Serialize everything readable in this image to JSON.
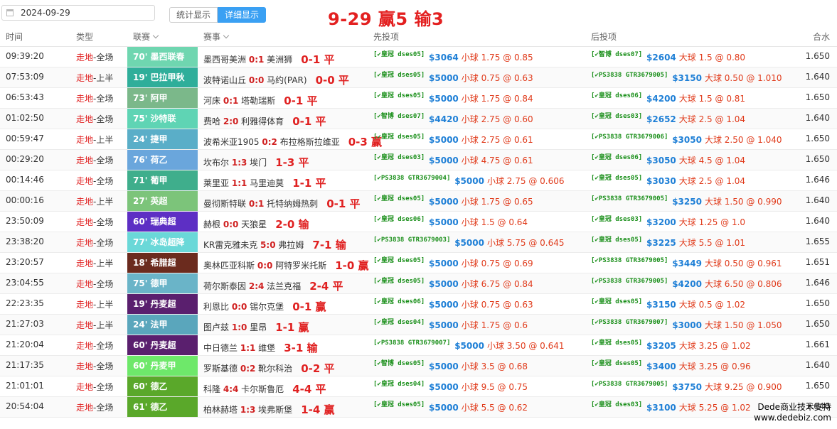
{
  "toolbar": {
    "date_value": "2024-09-29",
    "btn_stats": "统计显示",
    "btn_detail": "详细显示",
    "summary": "9-29 赢5 输3"
  },
  "headers": {
    "time": "时间",
    "type": "类型",
    "league": "联赛",
    "match": "赛事",
    "first_bet": "先投项",
    "second_bet": "后投项",
    "rate": "合水"
  },
  "rows": [
    {
      "time": "09:39:20",
      "type_a": "走地",
      "type_b": "-全场",
      "league": "70' 墨西联春",
      "league_color": "#6fd6b0",
      "home": "墨西哥美洲",
      "score": "0:1",
      "away": "美洲狮",
      "result": "0-1 平",
      "b1_acct": "[✔皇冠 dses05]",
      "b1_amt": "$3064",
      "b1_pick": "小球",
      "b1_odds": "1.75 @ 0.85",
      "b2_acct": "[✔智博 dses07]",
      "b2_amt": "$2604",
      "b2_pick": "大球",
      "b2_odds": "1.5 @ 0.80",
      "rate": "1.650"
    },
    {
      "time": "07:53:09",
      "type_a": "走地",
      "type_b": "-上半",
      "league": "19' 巴拉甲秋",
      "league_color": "#2fae9a",
      "home": "波特诺山丘",
      "score": "0:0",
      "away": "马约(PAR)",
      "result": "0-0 平",
      "b1_acct": "[✔皇冠 dses05]",
      "b1_amt": "$5000",
      "b1_pick": "小球",
      "b1_odds": "0.75 @ 0.63",
      "b2_acct": "[✔PS3838 GTR3679005]",
      "b2_amt": "$3150",
      "b2_pick": "大球",
      "b2_odds": "0.50 @ 1.010",
      "rate": "1.640"
    },
    {
      "time": "06:53:43",
      "type_a": "走地",
      "type_b": "-全场",
      "league": "73' 阿甲",
      "league_color": "#7bb88a",
      "home": "河床",
      "score": "0:1",
      "away": "塔勒瑞斯",
      "result": "0-1 平",
      "b1_acct": "[✔皇冠 dses05]",
      "b1_amt": "$5000",
      "b1_pick": "小球",
      "b1_odds": "1.75 @ 0.84",
      "b2_acct": "[✔皇冠 dses06]",
      "b2_amt": "$4200",
      "b2_pick": "大球",
      "b2_odds": "1.5 @ 0.81",
      "rate": "1.650"
    },
    {
      "time": "01:02:50",
      "type_a": "走地",
      "type_b": "-全场",
      "league": "75' 沙特联",
      "league_color": "#5fd4b4",
      "home": "费哈",
      "score": "2:0",
      "away": "利雅得体育",
      "result": "0-1 平",
      "b1_acct": "[✔智博 dses07]",
      "b1_amt": "$4420",
      "b1_pick": "小球",
      "b1_odds": "2.75 @ 0.60",
      "b2_acct": "[✔皇冠 dses03]",
      "b2_amt": "$2652",
      "b2_pick": "大球",
      "b2_odds": "2.5 @ 1.04",
      "rate": "1.640"
    },
    {
      "time": "00:59:47",
      "type_a": "走地",
      "type_b": "-上半",
      "league": "24' 捷甲",
      "league_color": "#5aaec8",
      "home": "波希米亚1905",
      "score": "0:2",
      "away": "布拉格斯拉维亚",
      "result": "0-3 赢",
      "b1_acct": "[✔皇冠 dses05]",
      "b1_amt": "$5000",
      "b1_pick": "小球",
      "b1_odds": "2.75 @ 0.61",
      "b2_acct": "[✔PS3838 GTR3679006]",
      "b2_amt": "$3050",
      "b2_pick": "大球",
      "b2_odds": "2.50 @ 1.040",
      "rate": "1.650"
    },
    {
      "time": "00:29:20",
      "type_a": "走地",
      "type_b": "-全场",
      "league": "76' 荷乙",
      "league_color": "#6aa6dc",
      "home": "坎布尔",
      "score": "1:3",
      "away": "埃门",
      "result": "1-3 平",
      "b1_acct": "[✔皇冠 dses03]",
      "b1_amt": "$5000",
      "b1_pick": "小球",
      "b1_odds": "4.75 @ 0.61",
      "b2_acct": "[✔皇冠 dses06]",
      "b2_amt": "$3050",
      "b2_pick": "大球",
      "b2_odds": "4.5 @ 1.04",
      "rate": "1.650"
    },
    {
      "time": "00:14:46",
      "type_a": "走地",
      "type_b": "-全场",
      "league": "71' 葡甲",
      "league_color": "#3fae8c",
      "home": "莱里亚",
      "score": "1:1",
      "away": "马里迪莫",
      "result": "1-1 平",
      "b1_acct": "[✔PS3838 GTR3679004]",
      "b1_amt": "$5000",
      "b1_pick": "小球",
      "b1_odds": "2.75 @ 0.606",
      "b2_acct": "[✔皇冠 dses05]",
      "b2_amt": "$3030",
      "b2_pick": "大球",
      "b2_odds": "2.5 @ 1.04",
      "rate": "1.646"
    },
    {
      "time": "00:00:16",
      "type_a": "走地",
      "type_b": "-上半",
      "league": "27' 英超",
      "league_color": "#7cc47a",
      "home": "曼彻斯特联",
      "score": "0:1",
      "away": "托特纳姆热刺",
      "result": "0-1 平",
      "b1_acct": "[✔皇冠 dses05]",
      "b1_amt": "$5000",
      "b1_pick": "小球",
      "b1_odds": "1.75 @ 0.65",
      "b2_acct": "[✔PS3838 GTR3679005]",
      "b2_amt": "$3250",
      "b2_pick": "大球",
      "b2_odds": "1.50 @ 0.990",
      "rate": "1.640"
    },
    {
      "time": "23:50:09",
      "type_a": "走地",
      "type_b": "-全场",
      "league": "60' 瑞典超",
      "league_color": "#5d2fc4",
      "home": "赫根",
      "score": "0:0",
      "away": "天狼星",
      "result": "2-0 输",
      "b1_acct": "[✔皇冠 dses06]",
      "b1_amt": "$5000",
      "b1_pick": "小球",
      "b1_odds": "1.5 @ 0.64",
      "b2_acct": "[✔皇冠 dses03]",
      "b2_amt": "$3200",
      "b2_pick": "大球",
      "b2_odds": "1.25 @ 1.0",
      "rate": "1.640"
    },
    {
      "time": "23:38:20",
      "type_a": "走地",
      "type_b": "-全场",
      "league": "77' 冰岛超降",
      "league_color": "#6ad8d8",
      "home": "KR雷克雅未克",
      "score": "5:0",
      "away": "弗拉姆",
      "result": "7-1 输",
      "b1_acct": "[✔PS3838 GTR3679003]",
      "b1_amt": "$5000",
      "b1_pick": "小球",
      "b1_odds": "5.75 @ 0.645",
      "b2_acct": "[✔皇冠 dses05]",
      "b2_amt": "$3225",
      "b2_pick": "大球",
      "b2_odds": "5.5 @ 1.01",
      "rate": "1.655"
    },
    {
      "time": "23:20:57",
      "type_a": "走地",
      "type_b": "-上半",
      "league": "18' 希腊超",
      "league_color": "#6b2b1e",
      "home": "奥林匹亚科斯",
      "score": "0:0",
      "away": "阿特罗米托斯",
      "result": "1-0 赢",
      "b1_acct": "[✔皇冠 dses05]",
      "b1_amt": "$5000",
      "b1_pick": "小球",
      "b1_odds": "0.75 @ 0.69",
      "b2_acct": "[✔PS3838 GTR3679005]",
      "b2_amt": "$3449",
      "b2_pick": "大球",
      "b2_odds": "0.50 @ 0.961",
      "rate": "1.651"
    },
    {
      "time": "23:04:55",
      "type_a": "走地",
      "type_b": "-全场",
      "league": "75' 德甲",
      "league_color": "#6ab4c8",
      "home": "荷尔斯泰因",
      "score": "2:4",
      "away": "法兰克福",
      "result": "2-4 平",
      "b1_acct": "[✔皇冠 dses05]",
      "b1_amt": "$5000",
      "b1_pick": "小球",
      "b1_odds": "6.75 @ 0.84",
      "b2_acct": "[✔PS3838 GTR3679005]",
      "b2_amt": "$4200",
      "b2_pick": "大球",
      "b2_odds": "6.50 @ 0.806",
      "rate": "1.646"
    },
    {
      "time": "22:23:35",
      "type_a": "走地",
      "type_b": "-上半",
      "league": "19' 丹麦超",
      "league_color": "#5a1f6e",
      "home": "利恩比",
      "score": "0:0",
      "away": "锡尔克堡",
      "result": "0-1 赢",
      "b1_acct": "[✔皇冠 dses06]",
      "b1_amt": "$5000",
      "b1_pick": "小球",
      "b1_odds": "0.75 @ 0.63",
      "b2_acct": "[✔皇冠 dses05]",
      "b2_amt": "$3150",
      "b2_pick": "大球",
      "b2_odds": "0.5 @ 1.02",
      "rate": "1.650"
    },
    {
      "time": "21:27:03",
      "type_a": "走地",
      "type_b": "-上半",
      "league": "24' 法甲",
      "league_color": "#5aa6bc",
      "home": "图卢兹",
      "score": "1:0",
      "away": "里昂",
      "result": "1-1 赢",
      "b1_acct": "[✔皇冠 dses04]",
      "b1_amt": "$5000",
      "b1_pick": "小球",
      "b1_odds": "1.75 @ 0.6",
      "b2_acct": "[✔PS3838 GTR3679007]",
      "b2_amt": "$3000",
      "b2_pick": "大球",
      "b2_odds": "1.50 @ 1.050",
      "rate": "1.650"
    },
    {
      "time": "21:20:04",
      "type_a": "走地",
      "type_b": "-全场",
      "league": "60' 丹麦超",
      "league_color": "#5a1f6e",
      "home": "中日德兰",
      "score": "1:1",
      "away": "维堡",
      "result": "3-1 输",
      "b1_acct": "[✔PS3838 GTR3679007]",
      "b1_amt": "$5000",
      "b1_pick": "小球",
      "b1_odds": "3.50 @ 0.641",
      "b2_acct": "[✔皇冠 dses05]",
      "b2_amt": "$3205",
      "b2_pick": "大球",
      "b2_odds": "3.25 @ 1.02",
      "rate": "1.661"
    },
    {
      "time": "21:17:35",
      "type_a": "走地",
      "type_b": "-全场",
      "league": "60' 丹麦甲",
      "league_color": "#6ee86a",
      "home": "罗斯基德",
      "score": "0:2",
      "away": "靴尔科治",
      "result": "0-2 平",
      "b1_acct": "[✔智博 dses05]",
      "b1_amt": "$5000",
      "b1_pick": "小球",
      "b1_odds": "3.5 @ 0.68",
      "b2_acct": "[✔皇冠 dses05]",
      "b2_amt": "$3400",
      "b2_pick": "大球",
      "b2_odds": "3.25 @ 0.96",
      "rate": "1.640"
    },
    {
      "time": "21:01:01",
      "type_a": "走地",
      "type_b": "-全场",
      "league": "60' 德乙",
      "league_color": "#5aa82a",
      "home": "科隆",
      "score": "4:4",
      "away": "卡尔斯鲁厄",
      "result": "4-4 平",
      "b1_acct": "[✔皇冠 dses04]",
      "b1_amt": "$5000",
      "b1_pick": "小球",
      "b1_odds": "9.5 @ 0.75",
      "b2_acct": "[✔PS3838 GTR3679005]",
      "b2_amt": "$3750",
      "b2_pick": "大球",
      "b2_odds": "9.25 @ 0.900",
      "rate": "1.650"
    },
    {
      "time": "20:54:04",
      "type_a": "走地",
      "type_b": "-全场",
      "league": "61' 德乙",
      "league_color": "#5aa82a",
      "home": "柏林赫塔",
      "score": "1:3",
      "away": "埃弗斯堡",
      "result": "1-4 赢",
      "b1_acct": "[✔皇冠 dses05]",
      "b1_amt": "$5000",
      "b1_pick": "小球",
      "b1_odds": "5.5 @ 0.62",
      "b2_acct": "[✔皇冠 dses03]",
      "b2_amt": "$3100",
      "b2_pick": "大球",
      "b2_odds": "5.25 @ 1.02",
      "rate": "1.640"
    }
  ],
  "watermark": {
    "line1": "Dede商业技术支持",
    "line2": "www.dedebiz.com"
  }
}
